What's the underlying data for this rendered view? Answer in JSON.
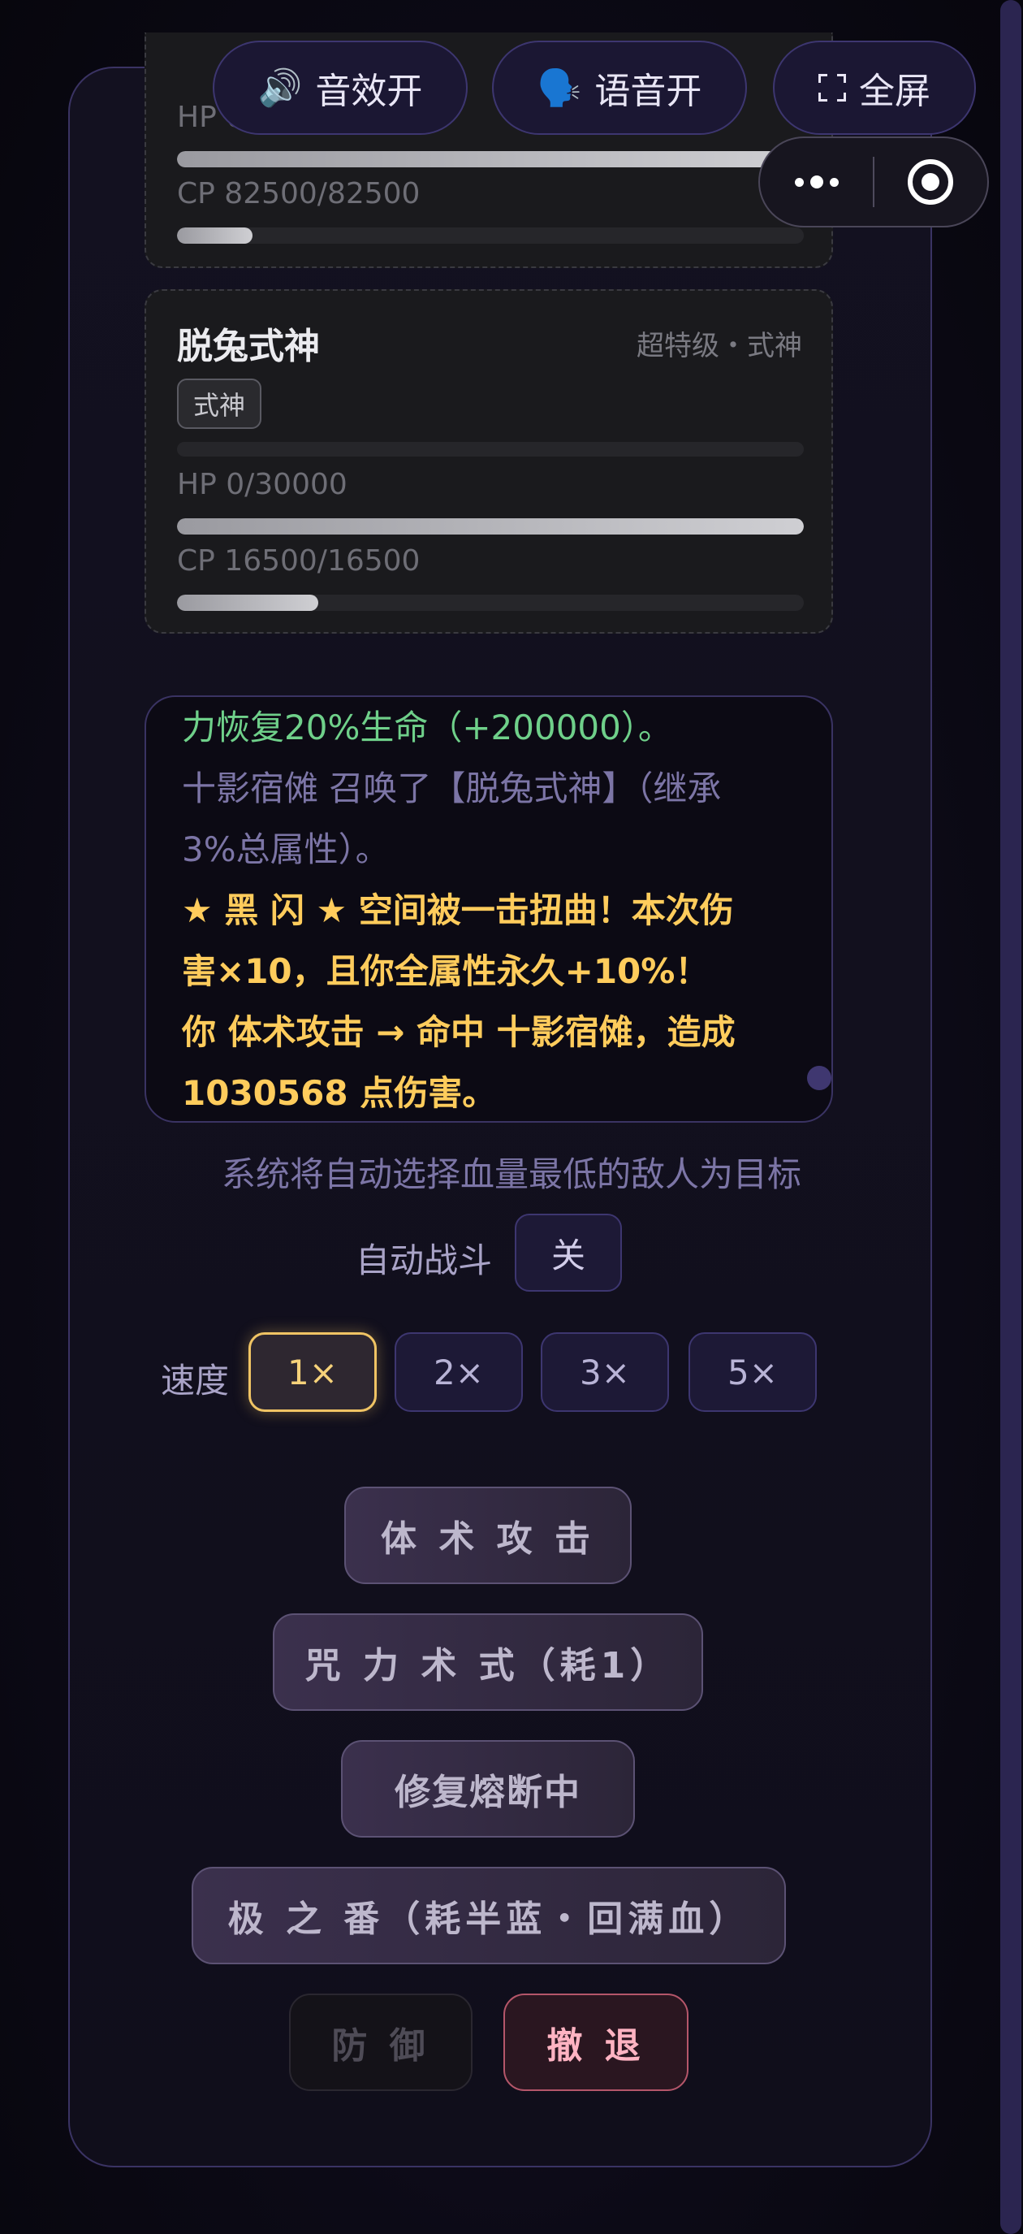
{
  "toolbar": {
    "sound_label": "音效开",
    "voice_label": "语音开",
    "fullscreen_label": "全屏"
  },
  "enemies": [
    {
      "hp_label": "HP 0",
      "hp_fraction": 1.0,
      "cp_label": "CP 82500/82500",
      "cp_fraction": 0.12
    },
    {
      "name": "脱兔式神",
      "rank": "超特级・式神",
      "tag": "式神",
      "hp_label": "HP 0/30000",
      "hp_fraction": 1.0,
      "cp_label": "CP 16500/16500",
      "cp_fraction": 0.225
    }
  ],
  "log": {
    "lines": [
      {
        "type": "heal",
        "text": "力恢复20%生命（+200000）。"
      },
      {
        "type": "sum",
        "text": "十影宿傩 召唤了【脱兔式神】（继承"
      },
      {
        "type": "sum",
        "text": "3%总属性）。"
      },
      {
        "type": "crit",
        "text": "★ 黑 闪 ★ 空间被一击扭曲！本次伤"
      },
      {
        "type": "crit",
        "text": "害×10，且你全属性永久+10%！"
      },
      {
        "type": "crit",
        "text": "你 体术攻击 → 命中 十影宿傩，造成"
      },
      {
        "type": "crit",
        "text": "1030568 点伤害。"
      }
    ]
  },
  "hint": "系统将自动选择血量最低的敌人为目标",
  "auto_battle": {
    "label": "自动战斗",
    "value": "关"
  },
  "speed": {
    "label": "速度",
    "options": [
      "1×",
      "2×",
      "3×",
      "5×"
    ],
    "selected": "1×"
  },
  "actions": {
    "melee": "体 术 攻 击",
    "curse": "咒 力 术 式（耗1）",
    "repair": "修复熔断中",
    "ultimate": "极 之 番（耗半蓝・回满血）",
    "defend": "防 御",
    "retreat": "撤 退"
  }
}
